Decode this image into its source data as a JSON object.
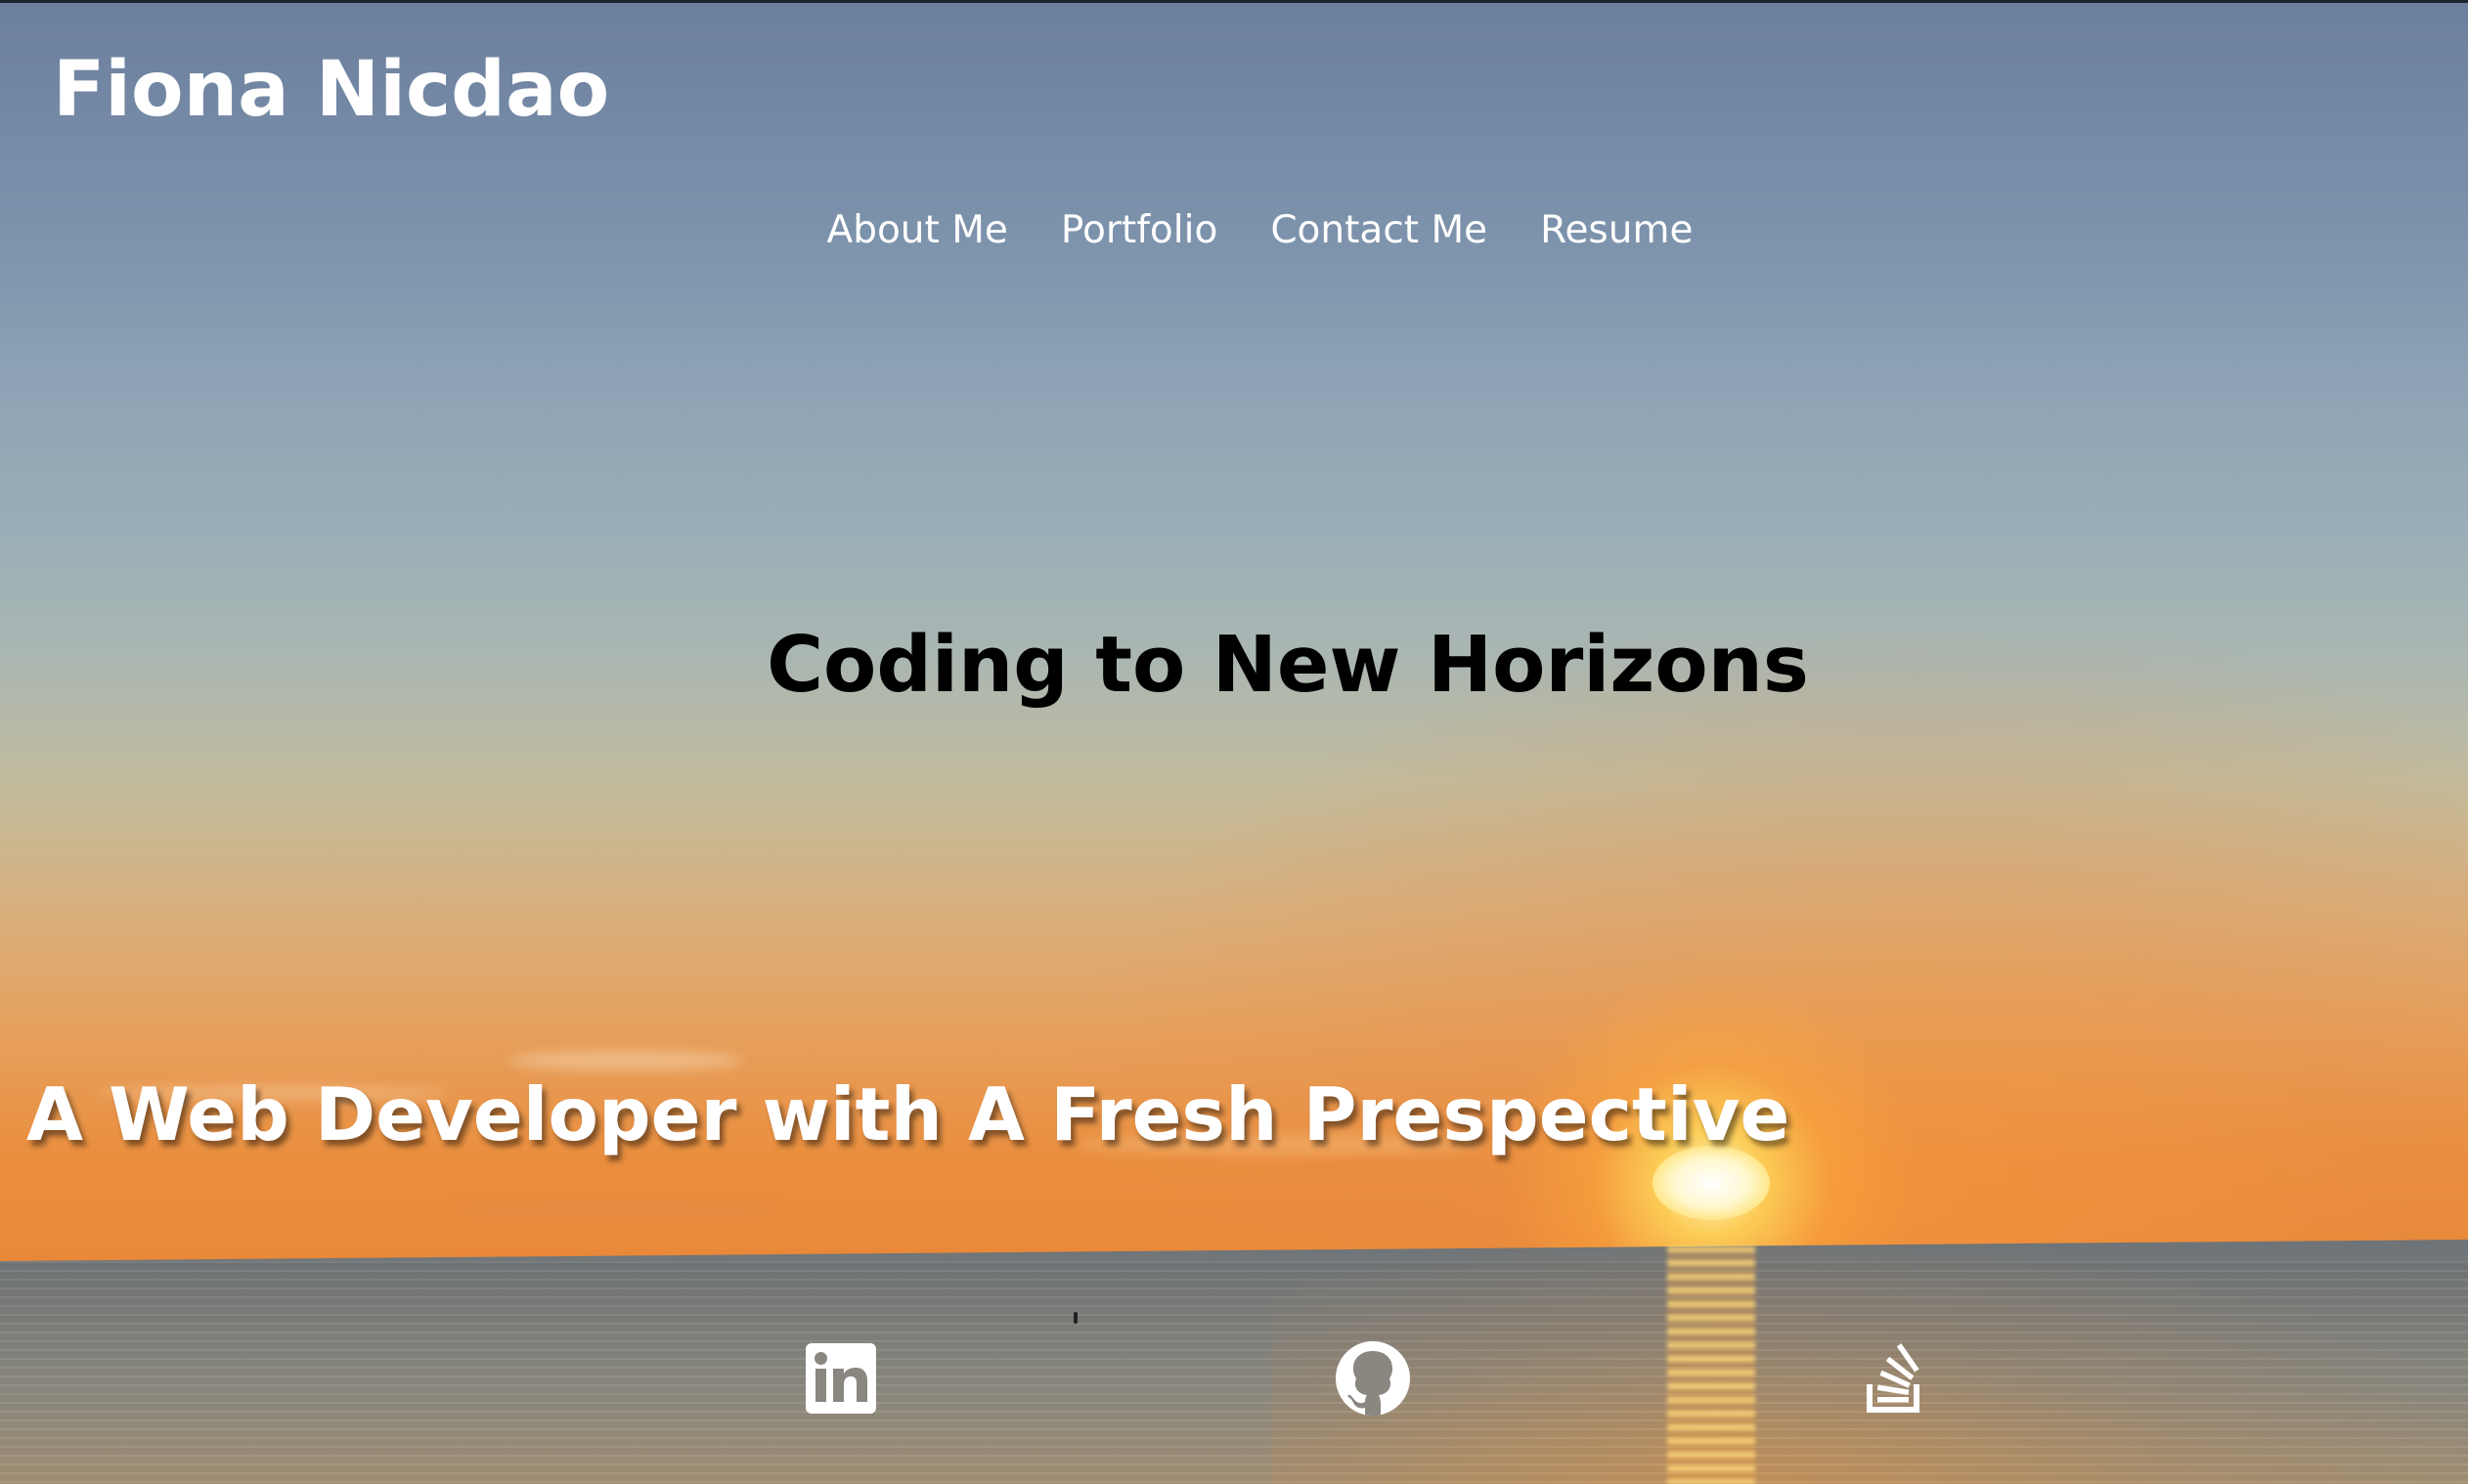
{
  "header": {
    "site_name": "Fiona Nicdao"
  },
  "nav": {
    "items": [
      {
        "label": "About Me"
      },
      {
        "label": "Portfolio"
      },
      {
        "label": "Contact Me"
      },
      {
        "label": "Resume"
      }
    ]
  },
  "hero": {
    "tagline": "Coding to New Horizons",
    "subtitle": "A Web Developer with A Fresh Prespective",
    "background_image": "sunset over the ocean horizon"
  },
  "social": {
    "icons": [
      {
        "name": "linkedin-icon"
      },
      {
        "name": "github-icon"
      },
      {
        "name": "stackoverflow-icon"
      }
    ]
  },
  "colors": {
    "text_primary": "#ffffff",
    "tagline_color": "#000000",
    "sky_top": "#6b7f9e",
    "sunset_orange": "#e98838"
  }
}
